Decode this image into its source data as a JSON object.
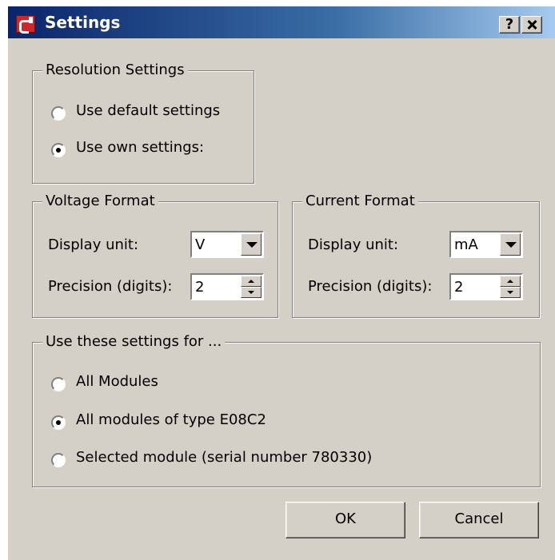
{
  "window": {
    "title": "Settings",
    "help_label": "?"
  },
  "resolution": {
    "legend": "Resolution Settings",
    "options": [
      {
        "label": "Use default settings",
        "selected": false
      },
      {
        "label": "Use own settings:",
        "selected": true
      }
    ]
  },
  "voltage": {
    "legend": "Voltage Format",
    "unit_label": "Display unit:",
    "unit_value": "V",
    "precision_label": "Precision (digits):",
    "precision_value": "2"
  },
  "current": {
    "legend": "Current Format",
    "unit_label": "Display unit:",
    "unit_value": "mA",
    "precision_label": "Precision (digits):",
    "precision_value": "2"
  },
  "apply_to": {
    "legend": "Use these settings for ...",
    "options": [
      {
        "label": "All Modules",
        "selected": false
      },
      {
        "label": "All modules of type E08C2",
        "selected": true
      },
      {
        "label": "Selected module (serial number 780330)",
        "selected": false
      }
    ]
  },
  "buttons": {
    "ok": "OK",
    "cancel": "Cancel"
  }
}
